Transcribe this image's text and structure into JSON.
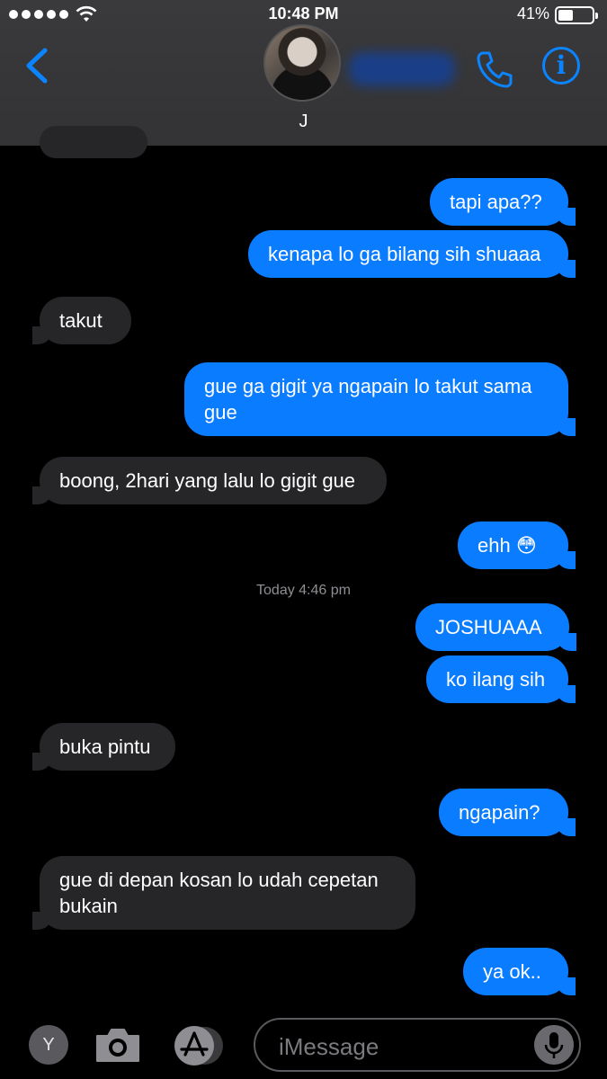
{
  "status_bar": {
    "time": "10:48 PM",
    "battery": "41%"
  },
  "header": {
    "contact_name": "J"
  },
  "thread": {
    "messages": [
      {
        "dir": "out",
        "text": "tapi apa??"
      },
      {
        "dir": "out",
        "text": "kenapa lo ga bilang sih shuaaa"
      },
      {
        "dir": "in",
        "text": "takut"
      },
      {
        "dir": "out",
        "text": "gue ga gigit ya ngapain lo takut sama gue"
      },
      {
        "dir": "in",
        "text": "boong, 2hari yang lalu lo gigit gue"
      },
      {
        "dir": "out",
        "text": "ehh 😳"
      },
      {
        "dir": "out",
        "text": "JOSHUAAA"
      },
      {
        "dir": "out",
        "text": "ko ilang sih"
      },
      {
        "dir": "in",
        "text": "buka pintu"
      },
      {
        "dir": "out",
        "text": "ngapain?"
      },
      {
        "dir": "in",
        "text": "gue di depan kosan lo udah cepetan bukain"
      },
      {
        "dir": "out",
        "text": "ya ok.."
      }
    ],
    "timestamp": "Today 4:46 pm"
  },
  "input_bar": {
    "app_label": "Y",
    "placeholder": "iMessage"
  },
  "colors": {
    "accent": "#0a84ff",
    "out_bubble": "#0a7cff",
    "in_bubble": "#262628"
  }
}
